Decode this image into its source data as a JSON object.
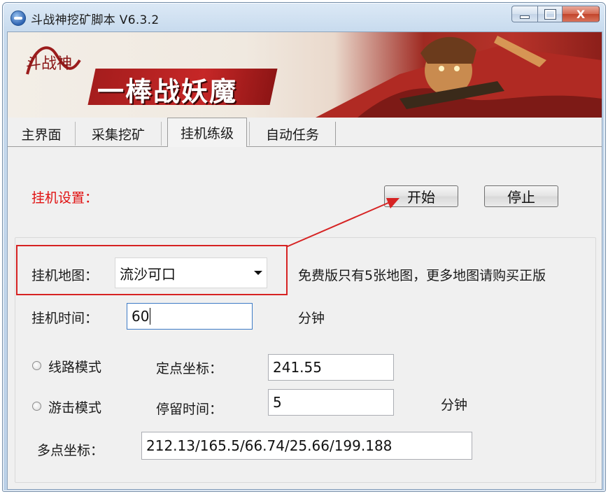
{
  "window": {
    "title": "斗战神挖矿脚本 V6.3.2",
    "controls": {
      "minimize": "minimize",
      "maximize": "maximize",
      "close": "X"
    }
  },
  "banner": {
    "logo_text": "斗战神",
    "slogan": "一棒战妖魔"
  },
  "tabs": [
    {
      "label": "主界面",
      "active": false
    },
    {
      "label": "采集挖矿",
      "active": false
    },
    {
      "label": "挂机练级",
      "active": true
    },
    {
      "label": "自动任务",
      "active": false
    }
  ],
  "panel": {
    "section_title": "挂机设置：",
    "start_button": "开始",
    "stop_button": "停止",
    "map_label": "挂机地图：",
    "map_value": "流沙可口",
    "map_note": "免费版只有5张地图，更多地图请购买正版",
    "time_label": "挂机时间：",
    "time_value": "60",
    "time_unit": "分钟",
    "route_mode": "线路模式",
    "fixed_point_label": "定点坐标：",
    "fixed_point_value": "241.55",
    "roam_mode": "游击模式",
    "stay_time_label": "停留时间：",
    "stay_time_value": "5",
    "stay_time_unit": "分钟",
    "multi_point_label": "多点坐标：",
    "multi_point_value": "212.13/165.5/66.74/25.66/199.188"
  },
  "colors": {
    "accent_red": "#e01010",
    "annotation_red": "#d62323"
  }
}
